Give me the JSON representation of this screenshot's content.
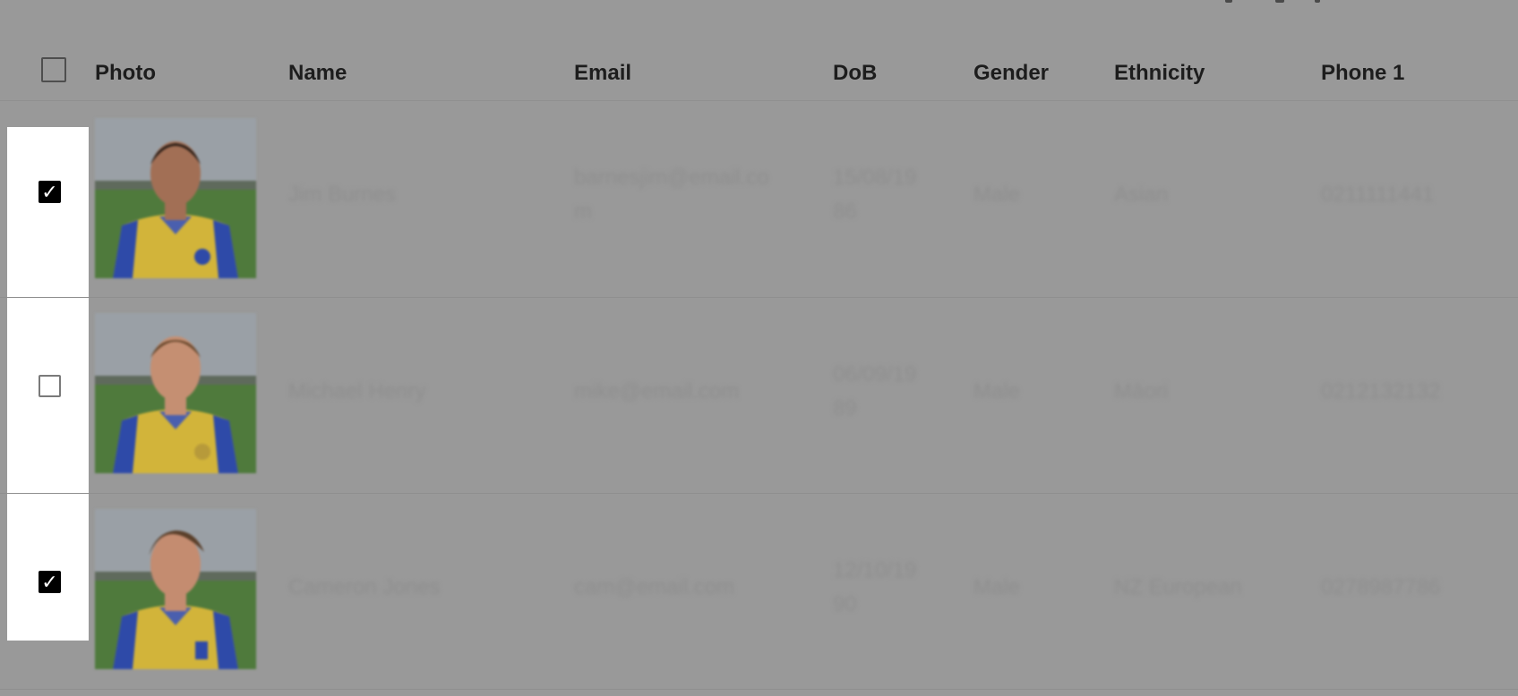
{
  "table": {
    "columns": [
      "Photo",
      "Name",
      "Email",
      "DoB",
      "Gender",
      "Ethnicity",
      "Phone 1"
    ],
    "rows": [
      {
        "checked": true,
        "check_mark": "✓",
        "name": "Jim Burnes",
        "email_line1": "barnesjim@email.co",
        "email_line2": "m",
        "dob_line1": "15/08/19",
        "dob_line2": "86",
        "gender": "Male",
        "ethnicity": "Asian",
        "phone": "0211111441",
        "photo_icon": "player-photo",
        "hair_color": "#2a1d16",
        "skin_color": "#a26f55"
      },
      {
        "checked": false,
        "check_mark": "",
        "name": "Michael Henry",
        "email_line1": "mike@email.com",
        "email_line2": "",
        "dob_line1": "06/09/19",
        "dob_line2": "89",
        "gender": "Male",
        "ethnicity": "Māori",
        "phone": "0212132132",
        "photo_icon": "player-photo",
        "hair_color": "#6b4a2f",
        "skin_color": "#c58f72"
      },
      {
        "checked": true,
        "check_mark": "✓",
        "name": "Cameron Jones",
        "email_line1": "cam@email.com",
        "email_line2": "",
        "dob_line1": "12/10/19",
        "dob_line2": "90",
        "gender": "Male",
        "ethnicity": "NZ European",
        "phone": "0278987786",
        "photo_icon": "player-photo",
        "hair_color": "#5a3f2a",
        "skin_color": "#c48c70"
      }
    ]
  },
  "colors": {
    "overlay": "#999999",
    "jersey_yellow": "#d2b43a",
    "jersey_blue": "#2e4aa8",
    "grass": "#4f7a3c"
  }
}
